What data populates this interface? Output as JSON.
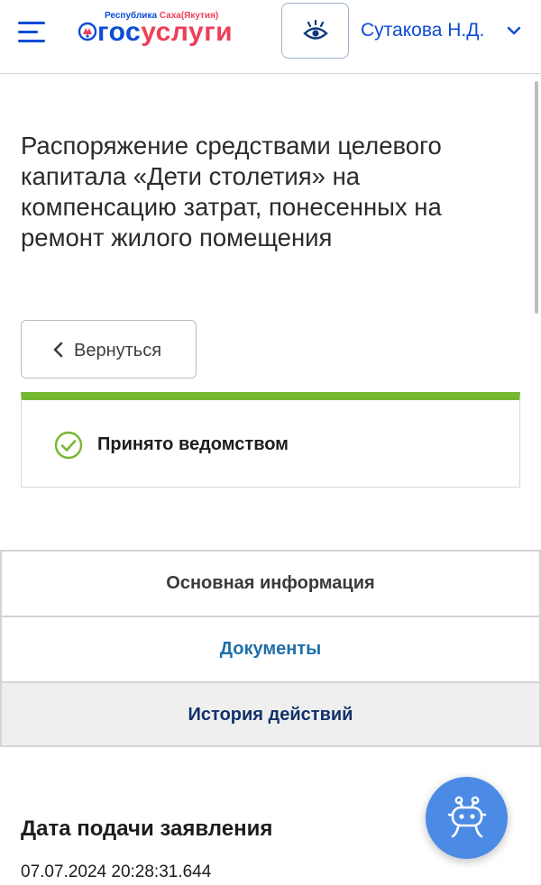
{
  "header": {
    "menu_icon": "hamburger-menu-icon",
    "logo": {
      "region_prefix": "Республика",
      "region_name": "Саха(Якутия)",
      "word_part1": "гос",
      "word_part2": "услуги",
      "emblem_icon": "region-emblem-icon"
    },
    "accessibility_icon": "eye-icon",
    "user_name": "Сутакова Н.Д.",
    "user_menu_icon": "chevron-down-icon"
  },
  "page": {
    "title": "Распоряжение средствами целевого капитала «Дети столетия» на компенсацию затрат, понесенных на ремонт жилого помещения",
    "back_button": {
      "label": "Вернуться",
      "icon": "chevron-left-icon"
    },
    "status": {
      "text": "Принято ведомством",
      "icon": "check-circle-icon",
      "accent_color": "#76b730"
    },
    "tabs": [
      {
        "label": "Основная информация"
      },
      {
        "label": "Документы"
      },
      {
        "label": "История действий"
      }
    ],
    "details": {
      "date_label": "Дата подачи заявления",
      "date_value": "07.07.2024 20:28:31.644"
    }
  },
  "chatbot": {
    "icon": "robot-assistant-icon"
  },
  "colors": {
    "brand_blue": "#0d4cd3",
    "brand_red": "#ee3f58",
    "status_green": "#76b730",
    "chatbot_blue": "#4b8be6"
  }
}
